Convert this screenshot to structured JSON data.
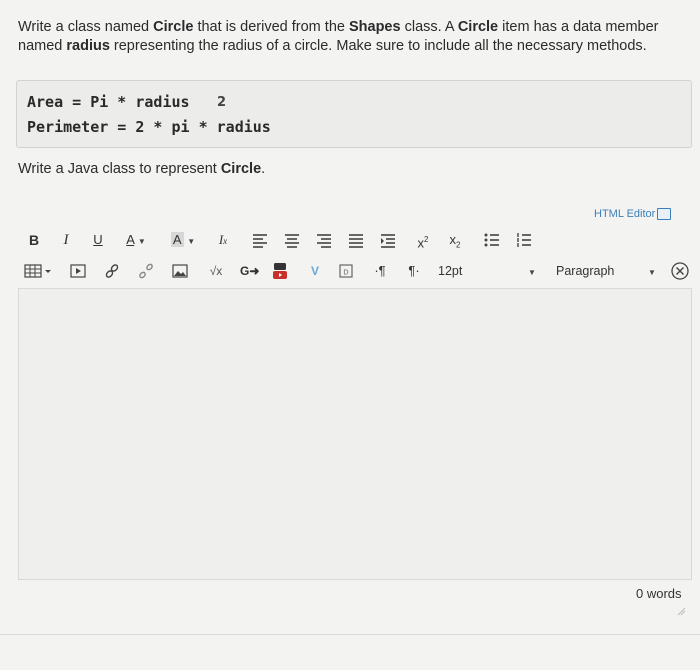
{
  "question": {
    "segments": [
      {
        "text": "Write a class named ",
        "bold": false
      },
      {
        "text": "Circle",
        "bold": true
      },
      {
        "text": " that is derived from the ",
        "bold": false
      },
      {
        "text": "Shapes",
        "bold": true
      },
      {
        "text": " class. A ",
        "bold": false
      },
      {
        "text": "Circle",
        "bold": true
      },
      {
        "text": " item has a data member named ",
        "bold": false
      },
      {
        "text": "radius",
        "bold": true
      },
      {
        "text": " representing the radius of a circle. Make sure to include all the necessary methods.",
        "bold": false
      }
    ]
  },
  "code": {
    "line1": "Area = Pi * radius",
    "exponent": "2",
    "line2": "Perimeter = 2 * pi * radius"
  },
  "subquestion": {
    "prefix": "Write a Java class to represent ",
    "emphasis": "Circle",
    "suffix": "."
  },
  "editor": {
    "html_editor_label": "HTML Editor",
    "font_size": "12pt",
    "block_format": "Paragraph",
    "word_count": "0 words"
  },
  "toolbar_icons": {
    "row1": [
      "bold-icon",
      "italic-icon",
      "underline-icon",
      "text-color-icon",
      "background-color-icon",
      "clear-formatting-icon",
      "align-left-icon",
      "align-center-icon",
      "align-right-icon",
      "align-justify-icon",
      "indent-icon",
      "superscript-icon",
      "subscript-icon",
      "bullet-list-icon",
      "numbered-list-icon"
    ],
    "row2": [
      "table-icon",
      "media-icon",
      "link-icon",
      "unlink-icon",
      "image-icon",
      "equation-icon",
      "google-drive-icon",
      "youtube-icon",
      "vimeo-icon",
      "document-icon",
      "ltr-icon",
      "rtl-icon"
    ]
  }
}
